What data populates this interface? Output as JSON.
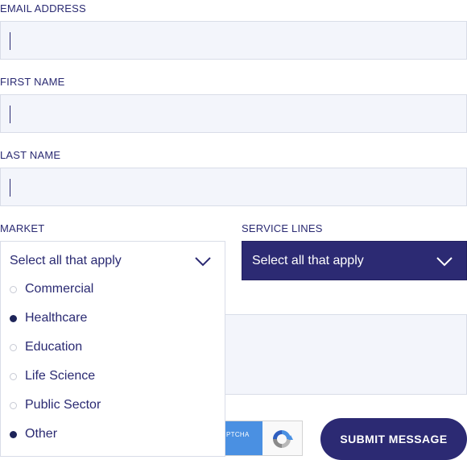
{
  "fields": {
    "email": {
      "label": "EMAIL ADDRESS",
      "value": ""
    },
    "first_name": {
      "label": "FIRST NAME",
      "value": ""
    },
    "last_name": {
      "label": "LAST NAME",
      "value": ""
    }
  },
  "market": {
    "label": "MARKET",
    "placeholder": "Select all that apply",
    "options": [
      {
        "label": "Commercial",
        "selected": false
      },
      {
        "label": "Healthcare",
        "selected": true
      },
      {
        "label": "Education",
        "selected": false
      },
      {
        "label": "Life Science",
        "selected": false
      },
      {
        "label": "Public Sector",
        "selected": false
      },
      {
        "label": "Other",
        "selected": true
      }
    ]
  },
  "service_lines": {
    "label": "SERVICE LINES",
    "placeholder": "Select all that apply"
  },
  "captcha": {
    "text": "PTCHA"
  },
  "submit": {
    "label": "SUBMIT MESSAGE"
  },
  "colors": {
    "navy": "#2c2a73",
    "field_bg": "#f3f5fb",
    "recaptcha_blue": "#4a90e2"
  },
  "icons": [
    "chevron-down-icon",
    "recaptcha-logo-icon"
  ]
}
